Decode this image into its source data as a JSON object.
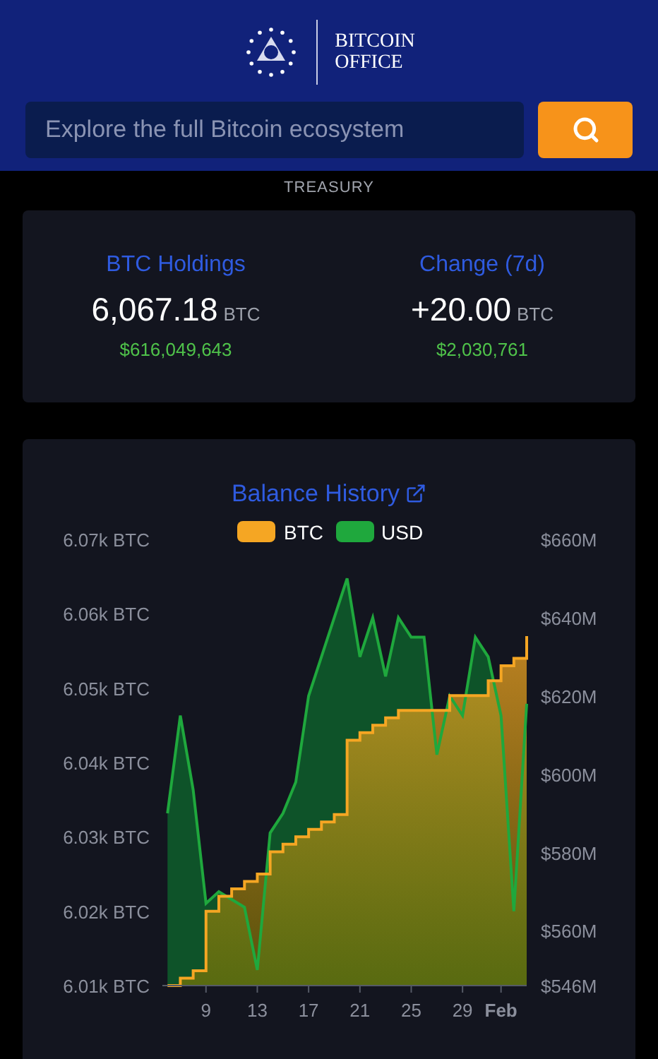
{
  "header": {
    "logo_lines": [
      "BITCOIN",
      "OFFICE"
    ],
    "search": {
      "placeholder": "Explore the full Bitcoin ecosystem"
    }
  },
  "section_label": "TREASURY",
  "stats": [
    {
      "label": "BTC Holdings",
      "value": "6,067.18",
      "unit": "BTC",
      "usd": "$616,049,643"
    },
    {
      "label": "Change (7d)",
      "value": "+20.00",
      "unit": "BTC",
      "usd": "$2,030,761"
    }
  ],
  "balance_history": {
    "title": "Balance History",
    "chart_data": {
      "type": "area",
      "x": [
        6,
        7,
        8,
        9,
        10,
        11,
        12,
        13,
        14,
        15,
        16,
        17,
        18,
        19,
        20,
        21,
        22,
        23,
        24,
        25,
        26,
        27,
        28,
        29,
        30,
        31,
        32,
        33,
        34
      ],
      "series": [
        {
          "name": "BTC",
          "color": "#f5a623",
          "values": [
            6010,
            6011,
            6012,
            6020,
            6022,
            6023,
            6024,
            6025,
            6028,
            6029,
            6030,
            6031,
            6032,
            6033,
            6043,
            6044,
            6045,
            6046,
            6047,
            6047,
            6047,
            6047,
            6049,
            6049,
            6049,
            6051,
            6053,
            6054,
            6057
          ]
        },
        {
          "name": "USD",
          "color": "#1fa83d",
          "axis": "y2",
          "values": [
            590,
            615,
            596,
            567,
            570,
            568,
            566,
            550,
            585,
            590,
            598,
            620,
            630,
            640,
            650,
            630,
            640,
            625,
            640,
            635,
            635,
            605,
            620,
            615,
            635,
            630,
            615,
            565,
            618
          ]
        }
      ],
      "xlim": [
        5.6,
        34
      ],
      "ylim": [
        6010,
        6070
      ],
      "y2lim": [
        546,
        660
      ],
      "legend": "top",
      "yticks": [
        {
          "value": 6070,
          "label": "6.07k BTC"
        },
        {
          "value": 6060,
          "label": "6.06k BTC"
        },
        {
          "value": 6050,
          "label": "6.05k BTC"
        },
        {
          "value": 6040,
          "label": "6.04k BTC"
        },
        {
          "value": 6030,
          "label": "6.03k BTC"
        },
        {
          "value": 6020,
          "label": "6.02k BTC"
        },
        {
          "value": 6010,
          "label": "6.01k BTC"
        }
      ],
      "y2ticks": [
        {
          "value": 660,
          "label": "$660M"
        },
        {
          "value": 640,
          "label": "$640M"
        },
        {
          "value": 620,
          "label": "$620M"
        },
        {
          "value": 600,
          "label": "$600M"
        },
        {
          "value": 580,
          "label": "$580M"
        },
        {
          "value": 560,
          "label": "$560M"
        },
        {
          "value": 546,
          "label": "$546M"
        }
      ],
      "xticks": [
        {
          "value": 9,
          "label": "9"
        },
        {
          "value": 13,
          "label": "13"
        },
        {
          "value": 17,
          "label": "17"
        },
        {
          "value": 21,
          "label": "21"
        },
        {
          "value": 25,
          "label": "25"
        },
        {
          "value": 29,
          "label": "29"
        },
        {
          "value": 32,
          "label": "Feb"
        }
      ]
    }
  }
}
